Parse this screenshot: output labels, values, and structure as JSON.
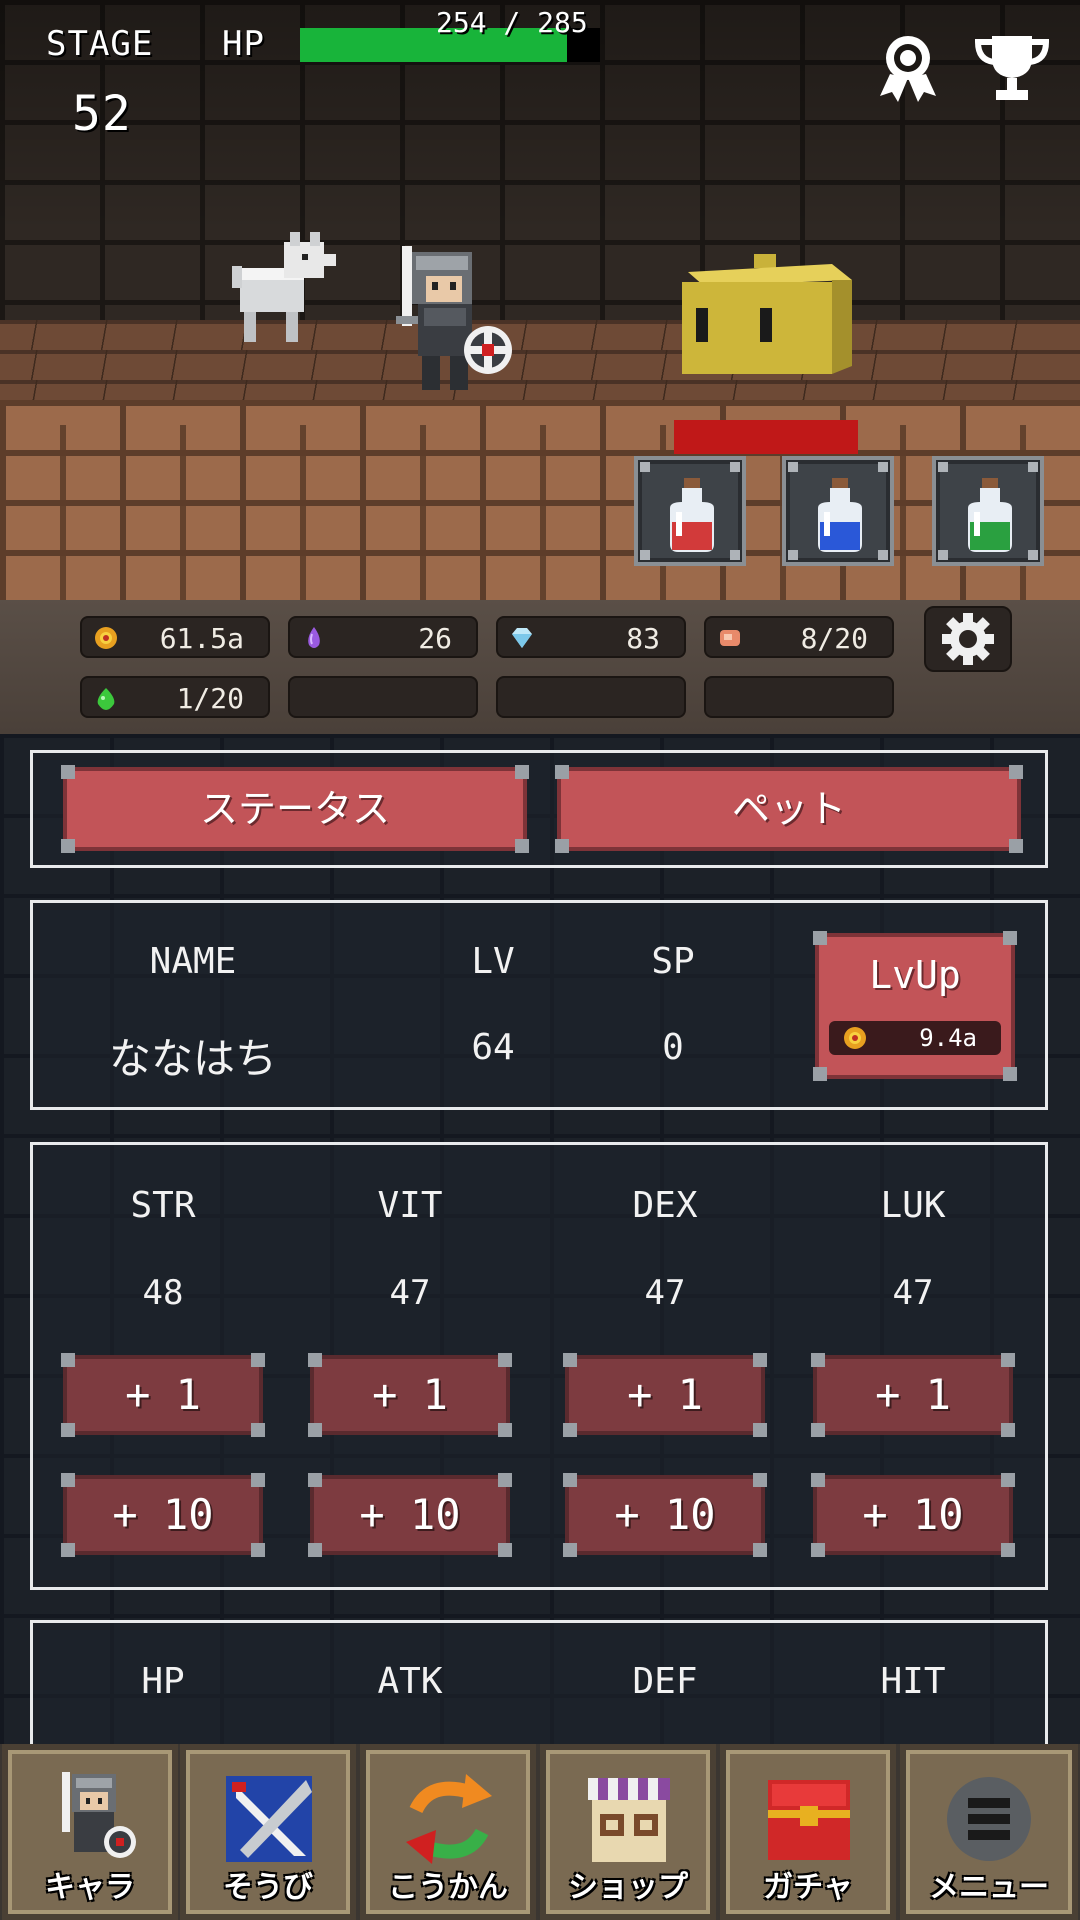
{
  "hud": {
    "stage_label": "STAGE",
    "stage_value": "52",
    "hp_label": "HP",
    "hp_text": "254 / 285",
    "hp_fraction": 0.891,
    "hp_color": "#18b43a",
    "icons": [
      "ribbon-icon",
      "trophy-icon"
    ]
  },
  "enemy": {
    "hp_fraction": 1.0,
    "hp_color": "#c01818"
  },
  "potions": [
    "red-potion-icon",
    "blue-potion-icon",
    "green-potion-icon"
  ],
  "resources": {
    "gold": "61.5a",
    "crystal": "26",
    "diamond": "83",
    "meat": "8/20",
    "slime": "1/20"
  },
  "tabs": {
    "status": "ステータス",
    "pet": "ペット"
  },
  "character": {
    "name_header": "NAME",
    "lv_header": "LV",
    "sp_header": "SP",
    "name": "ななはち",
    "lv": "64",
    "sp": "0",
    "lvup_label": "LvUp",
    "lvup_cost": "9.4a"
  },
  "stats": {
    "headers": [
      "STR",
      "VIT",
      "DEX",
      "LUK"
    ],
    "values": [
      "48",
      "47",
      "47",
      "47"
    ],
    "plus1": "+ 1",
    "plus10": "+ 10"
  },
  "derived_headers": [
    "HP",
    "ATK",
    "DEF",
    "HIT"
  ],
  "nav": [
    {
      "label": "キャラ"
    },
    {
      "label": "そうび"
    },
    {
      "label": "こうかん"
    },
    {
      "label": "ショップ"
    },
    {
      "label": "ガチャ"
    },
    {
      "label": "メニュー"
    }
  ]
}
